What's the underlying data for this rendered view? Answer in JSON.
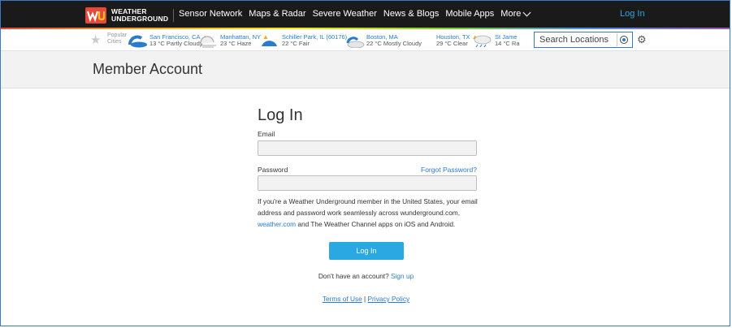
{
  "brand": {
    "line1": "WEATHER",
    "line2": "UNDERGROUND"
  },
  "nav": {
    "items": [
      "Sensor Network",
      "Maps & Radar",
      "Severe Weather",
      "News & Blogs",
      "Mobile Apps"
    ],
    "more": "More",
    "login": "Log In"
  },
  "cities": {
    "popular": [
      "Popular",
      "Cities"
    ],
    "list": [
      {
        "name": "San Francisco, CA",
        "cond": "13 °C Partly Cloudy",
        "alert": true,
        "icon": "partly-cloudy-icon"
      },
      {
        "name": "Manhattan, NY",
        "cond": "23 °C Haze",
        "alert": true,
        "icon": "haze-icon"
      },
      {
        "name": "Schiller Park, IL (60176)",
        "cond": "22 °C Fair",
        "alert": false,
        "icon": "fair-icon"
      },
      {
        "name": "Boston, MA",
        "cond": "22 °C Mostly Cloudy",
        "alert": false,
        "icon": "mostly-cloudy-icon"
      },
      {
        "name": "Houston, TX",
        "cond": "29 °C Clear",
        "alert": true,
        "icon": "clear-night-icon"
      },
      {
        "name": "St Jame",
        "cond": "14 °C Ra",
        "alert": false,
        "icon": "rain-icon"
      }
    ]
  },
  "search": {
    "placeholder": "Search Locations"
  },
  "page": {
    "title": "Member Account"
  },
  "form": {
    "heading": "Log In",
    "email_label": "Email",
    "email_value": "",
    "password_label": "Password",
    "password_value": "",
    "forgot": "Forgot Password?",
    "info_text": "If you're a Weather Underground member in the United States, your email address and password work seamlessly across wunderground.com,",
    "info_link": "weather.com",
    "info_tail": " and The Weather Channel apps on iOS and Android.",
    "button": "Log In",
    "no_account": "Don't have an account?",
    "signup": "Sign up"
  },
  "footer": {
    "terms": "Terms of Use",
    "separator": "|",
    "privacy": "Privacy Policy"
  },
  "colors": {
    "accent": "#29a8e2",
    "link": "#2a7bc9",
    "nav_bg": "#1a1a1a",
    "alert": "#f5a623"
  }
}
